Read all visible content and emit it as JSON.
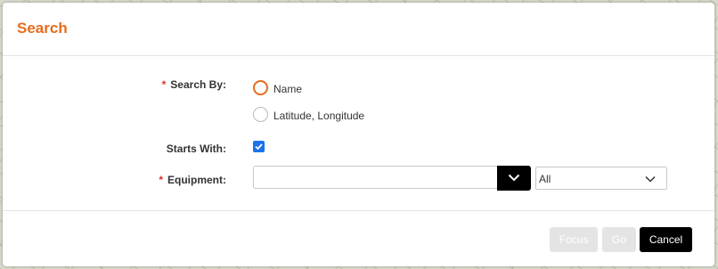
{
  "dialog": {
    "title": "Search"
  },
  "form": {
    "search_by": {
      "label": "Search By:",
      "required": true,
      "options": [
        {
          "label": "Name",
          "selected": true
        },
        {
          "label": "Latitude, Longitude",
          "selected": false
        }
      ]
    },
    "starts_with": {
      "label": "Starts With:",
      "checked": true
    },
    "equipment": {
      "label": "Equipment:",
      "required": true,
      "input_value": "",
      "filter_value": "All"
    }
  },
  "footer": {
    "focus_label": "Focus",
    "go_label": "Go",
    "cancel_label": "Cancel"
  },
  "colors": {
    "accent": "#e66b1e",
    "required": "#d9342b",
    "checkbox": "#1a73e8"
  }
}
